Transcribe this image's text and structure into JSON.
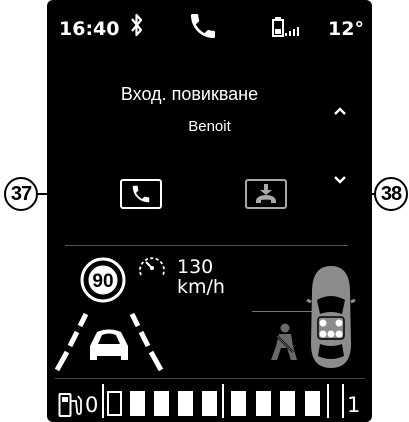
{
  "status_bar": {
    "time": "16:40",
    "temperature": "12°",
    "icons": [
      "bluetooth-icon",
      "phone-icon",
      "battery-icon",
      "signal-icon"
    ]
  },
  "call": {
    "title": "Вход. повикване",
    "caller": "Benoit",
    "buttons": [
      "accept-call-button",
      "reject-call-button"
    ]
  },
  "driving": {
    "speed_limit": "90",
    "cruise_speed": "130",
    "cruise_unit": "km/h",
    "icons": [
      "speedometer-icon",
      "lane-assist-icon",
      "seatbelt-icon",
      "car-top-view-icon"
    ]
  },
  "gear_bar": {
    "min_label": "0",
    "max_label": "1",
    "icon": "fuel-pump-icon"
  },
  "callouts": {
    "left": "37",
    "right": "38"
  },
  "colors": {
    "screen_background": "#000000",
    "foreground": "#ffffff",
    "muted": "#a8a8a8"
  }
}
